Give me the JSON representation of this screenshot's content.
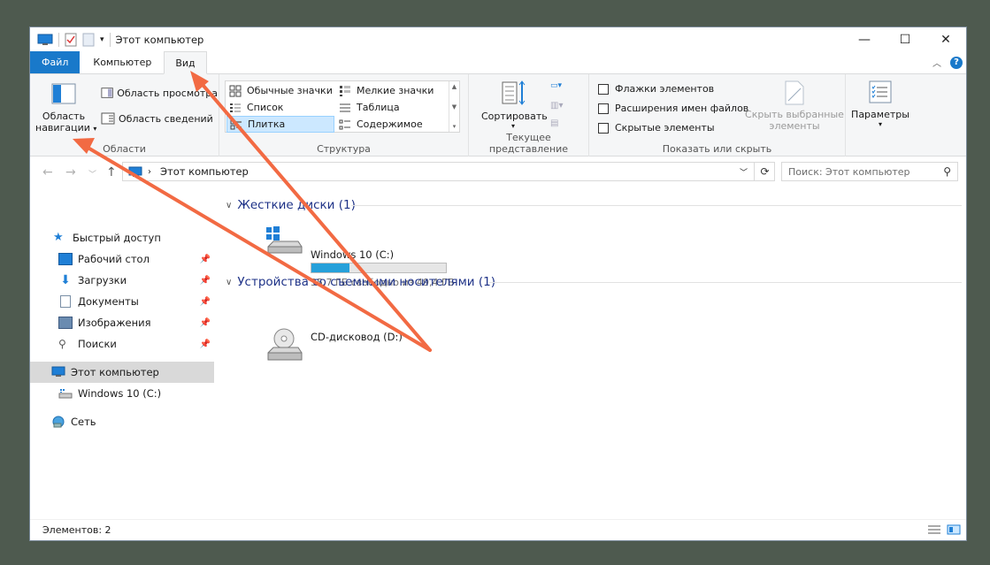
{
  "window": {
    "title": "Этот компьютер",
    "minimize": "—",
    "maximize": "☐",
    "close": "✕"
  },
  "tabs": [
    {
      "label": "Файл"
    },
    {
      "label": "Компьютер"
    },
    {
      "label": "Вид"
    }
  ],
  "ribbon": {
    "panes": {
      "nav_pane_label_1": "Область",
      "nav_pane_label_2": "навигации",
      "preview_pane": "Область просмотра",
      "details_pane": "Область сведений",
      "group_label": "Области"
    },
    "layout": {
      "items": [
        "Обычные значки",
        "Мелкие значки",
        "Список",
        "Таблица",
        "Плитка",
        "Содержимое"
      ],
      "selected": "Плитка",
      "group_label": "Структура"
    },
    "current_view": {
      "sort_label": "Сортировать",
      "group_label": "Текущее представление"
    },
    "show_hide": {
      "checkboxes": [
        "Флажки элементов",
        "Расширения имен файлов",
        "Скрытые элементы"
      ],
      "hide_selected_1": "Скрыть выбранные",
      "hide_selected_2": "элементы",
      "group_label": "Показать или скрыть"
    },
    "options": {
      "label": "Параметры"
    }
  },
  "address": {
    "path": "Этот компьютер",
    "search_placeholder": "Поиск: Этот компьютер"
  },
  "nav": {
    "quick_access": "Быстрый доступ",
    "items": [
      "Рабочий стол",
      "Загрузки",
      "Документы",
      "Изображения",
      "Поиски"
    ],
    "this_pc": "Этот компьютер",
    "drive": "Windows 10 (C:)",
    "network": "Сеть"
  },
  "content": {
    "section_hdd": "Жесткие диски (1)",
    "drive_c_name": "Windows 10 (C:)",
    "drive_c_free": "35,7 ГБ свободно из 49,4 ГБ",
    "drive_c_used_fraction": 0.28,
    "section_removable": "Устройства со съемными носителями (1)",
    "drive_d_name": "CD-дисковод (D:)"
  },
  "status": {
    "items": "Элементов: 2"
  },
  "colors": {
    "accent": "#1979ca",
    "annotation_arrow": "#f26a43",
    "progress": "#26a0da"
  }
}
